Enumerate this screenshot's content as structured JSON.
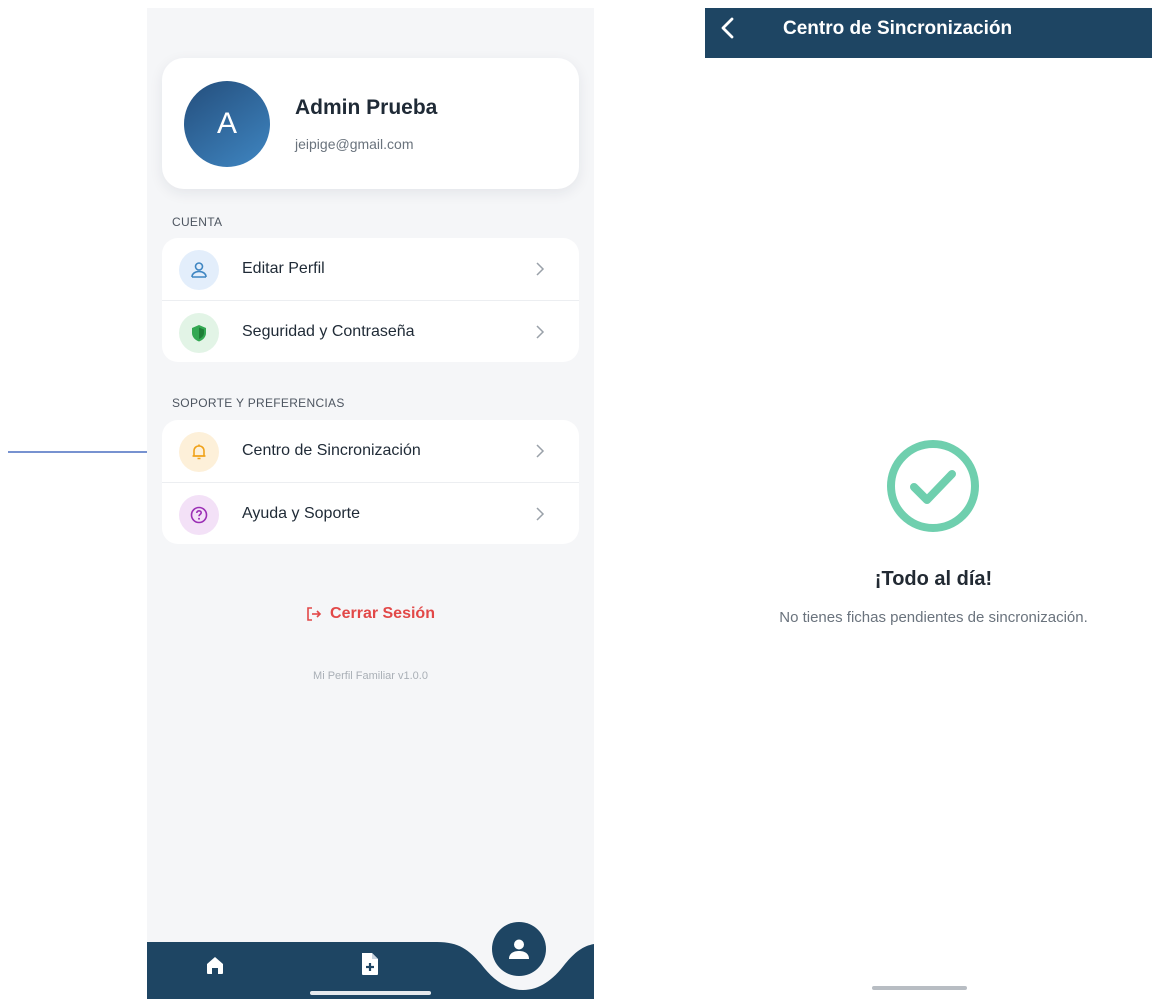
{
  "colors": {
    "navy": "#1e4563",
    "accent_blue": "#3f86c2",
    "danger": "#e24848",
    "success": "#6fcfae",
    "arrow": "#4a6fc1"
  },
  "left_screen": {
    "profile": {
      "avatar_letter": "A",
      "name": "Admin Prueba",
      "email": "jeipige@gmail.com"
    },
    "sections": [
      {
        "title": "CUENTA",
        "items": [
          {
            "label": "Editar Perfil",
            "icon": "user-icon"
          },
          {
            "label": "Seguridad y Contraseña",
            "icon": "shield-icon"
          }
        ]
      },
      {
        "title": "SOPORTE Y PREFERENCIAS",
        "items": [
          {
            "label": "Centro de Sincronización",
            "icon": "bell-icon"
          },
          {
            "label": "Ayuda y Soporte",
            "icon": "help-icon"
          }
        ]
      }
    ],
    "logout_label": "Cerrar Sesión",
    "version": "Mi Perfil Familiar v1.0.0",
    "nav_items": [
      "home-icon",
      "add-document-icon",
      "profile-icon"
    ]
  },
  "right_screen": {
    "header_title": "Centro de Sincronización",
    "status_title": "¡Todo al día!",
    "status_subtitle": "No tienes fichas pendientes de sincronización."
  }
}
